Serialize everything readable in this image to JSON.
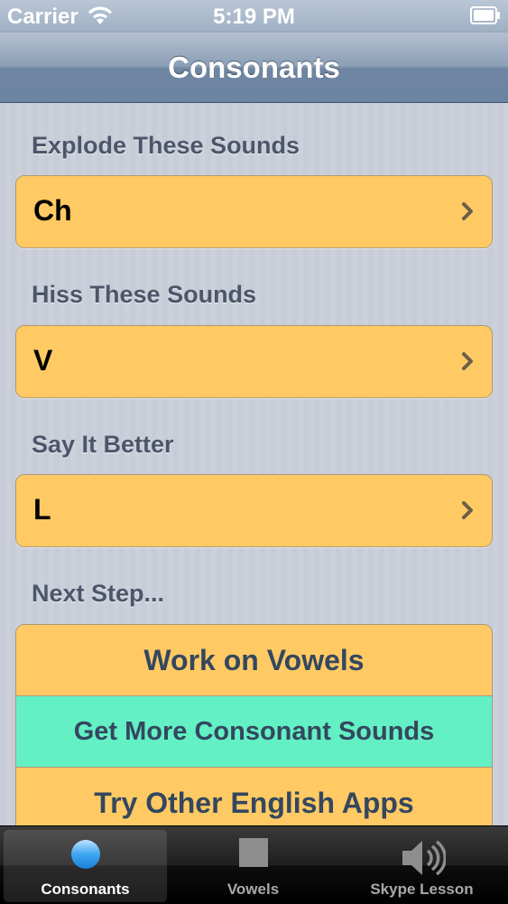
{
  "status_bar": {
    "carrier": "Carrier",
    "time": "5:19 PM"
  },
  "nav": {
    "title": "Consonants"
  },
  "sections": [
    {
      "header": "Explode These Sounds",
      "cell": "Ch"
    },
    {
      "header": "Hiss These Sounds",
      "cell": "V"
    },
    {
      "header": "Say It Better",
      "cell": "L"
    }
  ],
  "next_step": {
    "header": "Next Step...",
    "buttons": [
      "Work on Vowels",
      "Get More Consonant Sounds",
      "Try Other English Apps"
    ]
  },
  "tabs": [
    {
      "label": "Consonants",
      "icon": "circle-icon"
    },
    {
      "label": "Vowels",
      "icon": "square-icon"
    },
    {
      "label": "Skype Lesson",
      "icon": "speaker-icon"
    }
  ],
  "colors": {
    "cell": "#ffca63",
    "highlight_button": "#63f0c4",
    "nav": "#6f86a3"
  }
}
